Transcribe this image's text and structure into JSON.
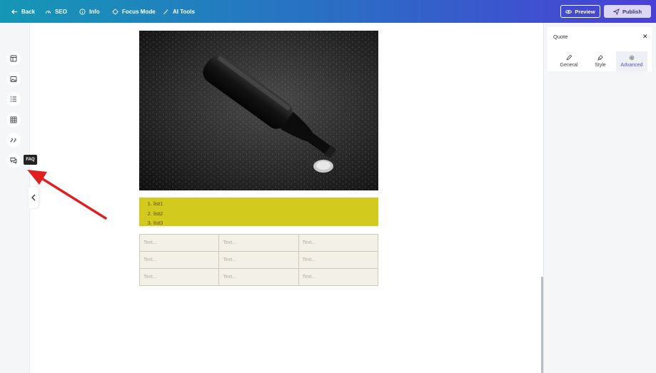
{
  "topbar": {
    "back": "Back",
    "seo": "SEO",
    "info": "Info",
    "focus_mode": "Focus Mode",
    "ai_tools": "AI Tools",
    "preview": "Preview",
    "publish": "Publish"
  },
  "rail": {
    "items": [
      "layout-icon",
      "image-icon",
      "list-icon",
      "table-icon",
      "quote-icon",
      "faq-icon"
    ],
    "tooltip": "FAQ"
  },
  "canvas": {
    "list_items": [
      "list1",
      "list2",
      "list3"
    ],
    "table_rows": [
      [
        "Text...",
        "Text...",
        "Text..."
      ],
      [
        "Text...",
        "Text...",
        "Text..."
      ],
      [
        "Text...",
        "Text...",
        "Text..."
      ]
    ],
    "list_bg": "#d2cb1e"
  },
  "panel": {
    "title": "Quote",
    "tabs": [
      "General",
      "Style",
      "Advanced"
    ],
    "active_tab": "Advanced"
  },
  "colors": {
    "accent": "#5a52c9",
    "annotation_arrow": "#e02020"
  }
}
